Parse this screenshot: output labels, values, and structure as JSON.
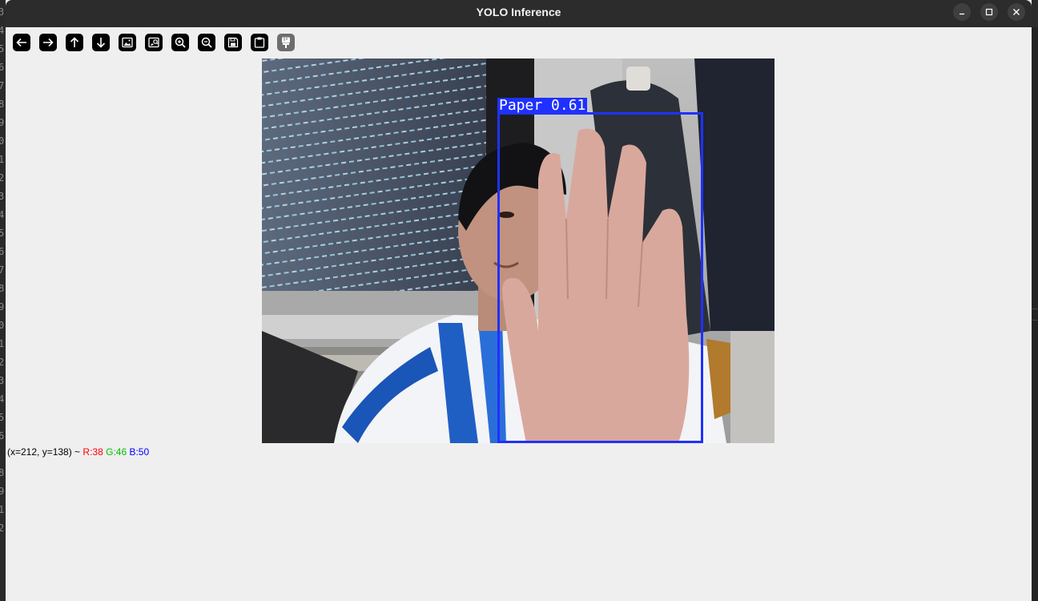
{
  "window": {
    "title": "YOLO Inference"
  },
  "window_controls": [
    {
      "name": "minimize",
      "icon": "minimize-icon"
    },
    {
      "name": "maximize",
      "icon": "maximize-icon"
    },
    {
      "name": "close",
      "icon": "close-icon"
    }
  ],
  "toolbar": [
    {
      "name": "back",
      "icon": "arrow-left-icon"
    },
    {
      "name": "forward",
      "icon": "arrow-right-icon"
    },
    {
      "name": "up",
      "icon": "arrow-up-icon"
    },
    {
      "name": "down",
      "icon": "arrow-down-icon"
    },
    {
      "name": "zoom-image",
      "icon": "image-icon"
    },
    {
      "name": "zoom-region",
      "icon": "image-zoom-icon"
    },
    {
      "name": "zoom-in",
      "icon": "zoom-in-icon"
    },
    {
      "name": "zoom-out",
      "icon": "zoom-out-icon"
    },
    {
      "name": "save",
      "icon": "save-icon"
    },
    {
      "name": "copy",
      "icon": "clipboard-icon"
    },
    {
      "name": "properties",
      "icon": "paint-brush-icon",
      "disabled": true
    }
  ],
  "detection": {
    "label": "Paper 0.61",
    "class": "Paper",
    "confidence": 0.61,
    "color": "#1f31ff"
  },
  "status": {
    "coords": "(x=212, y=138) ~ ",
    "r": "R:38",
    "g": "G:46",
    "b": "B:50"
  },
  "colors": {
    "window_bg": "#efefef",
    "titlebar": "#2c2c2c",
    "box": "#1f31ff"
  }
}
